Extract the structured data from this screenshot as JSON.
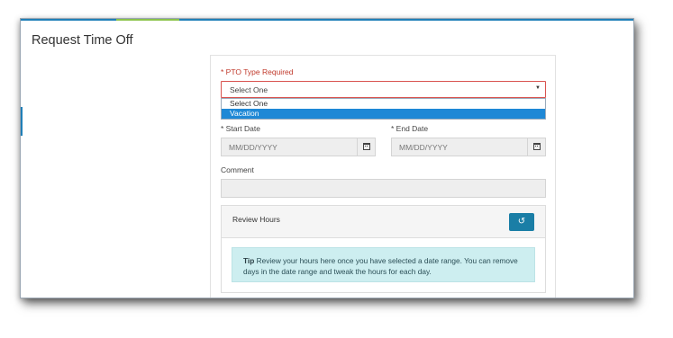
{
  "page": {
    "title": "Request Time Off"
  },
  "form": {
    "pto_type": {
      "label": "* PTO Type Required",
      "selected": "Select One",
      "options": [
        "Select One",
        "Vacation"
      ],
      "highlighted_option": "Vacation"
    },
    "start_date": {
      "label": "* Start Date",
      "placeholder": "MM/DD/YYYY"
    },
    "end_date": {
      "label": "* End Date",
      "placeholder": "MM/DD/YYYY"
    },
    "comment": {
      "label": "Comment",
      "value": ""
    }
  },
  "review": {
    "title": "Review Hours",
    "reset_icon": "undo-icon",
    "tip_label": "Tip",
    "tip_text": "Review your hours here once you have selected a date range. You can remove days in the date range and tweak the hours for each day."
  },
  "colors": {
    "accent": "#1f7fb8",
    "error": "#d9534f",
    "selected_option": "#1e88d6",
    "button": "#1a7ea6",
    "tip_background": "#cdeef0"
  }
}
